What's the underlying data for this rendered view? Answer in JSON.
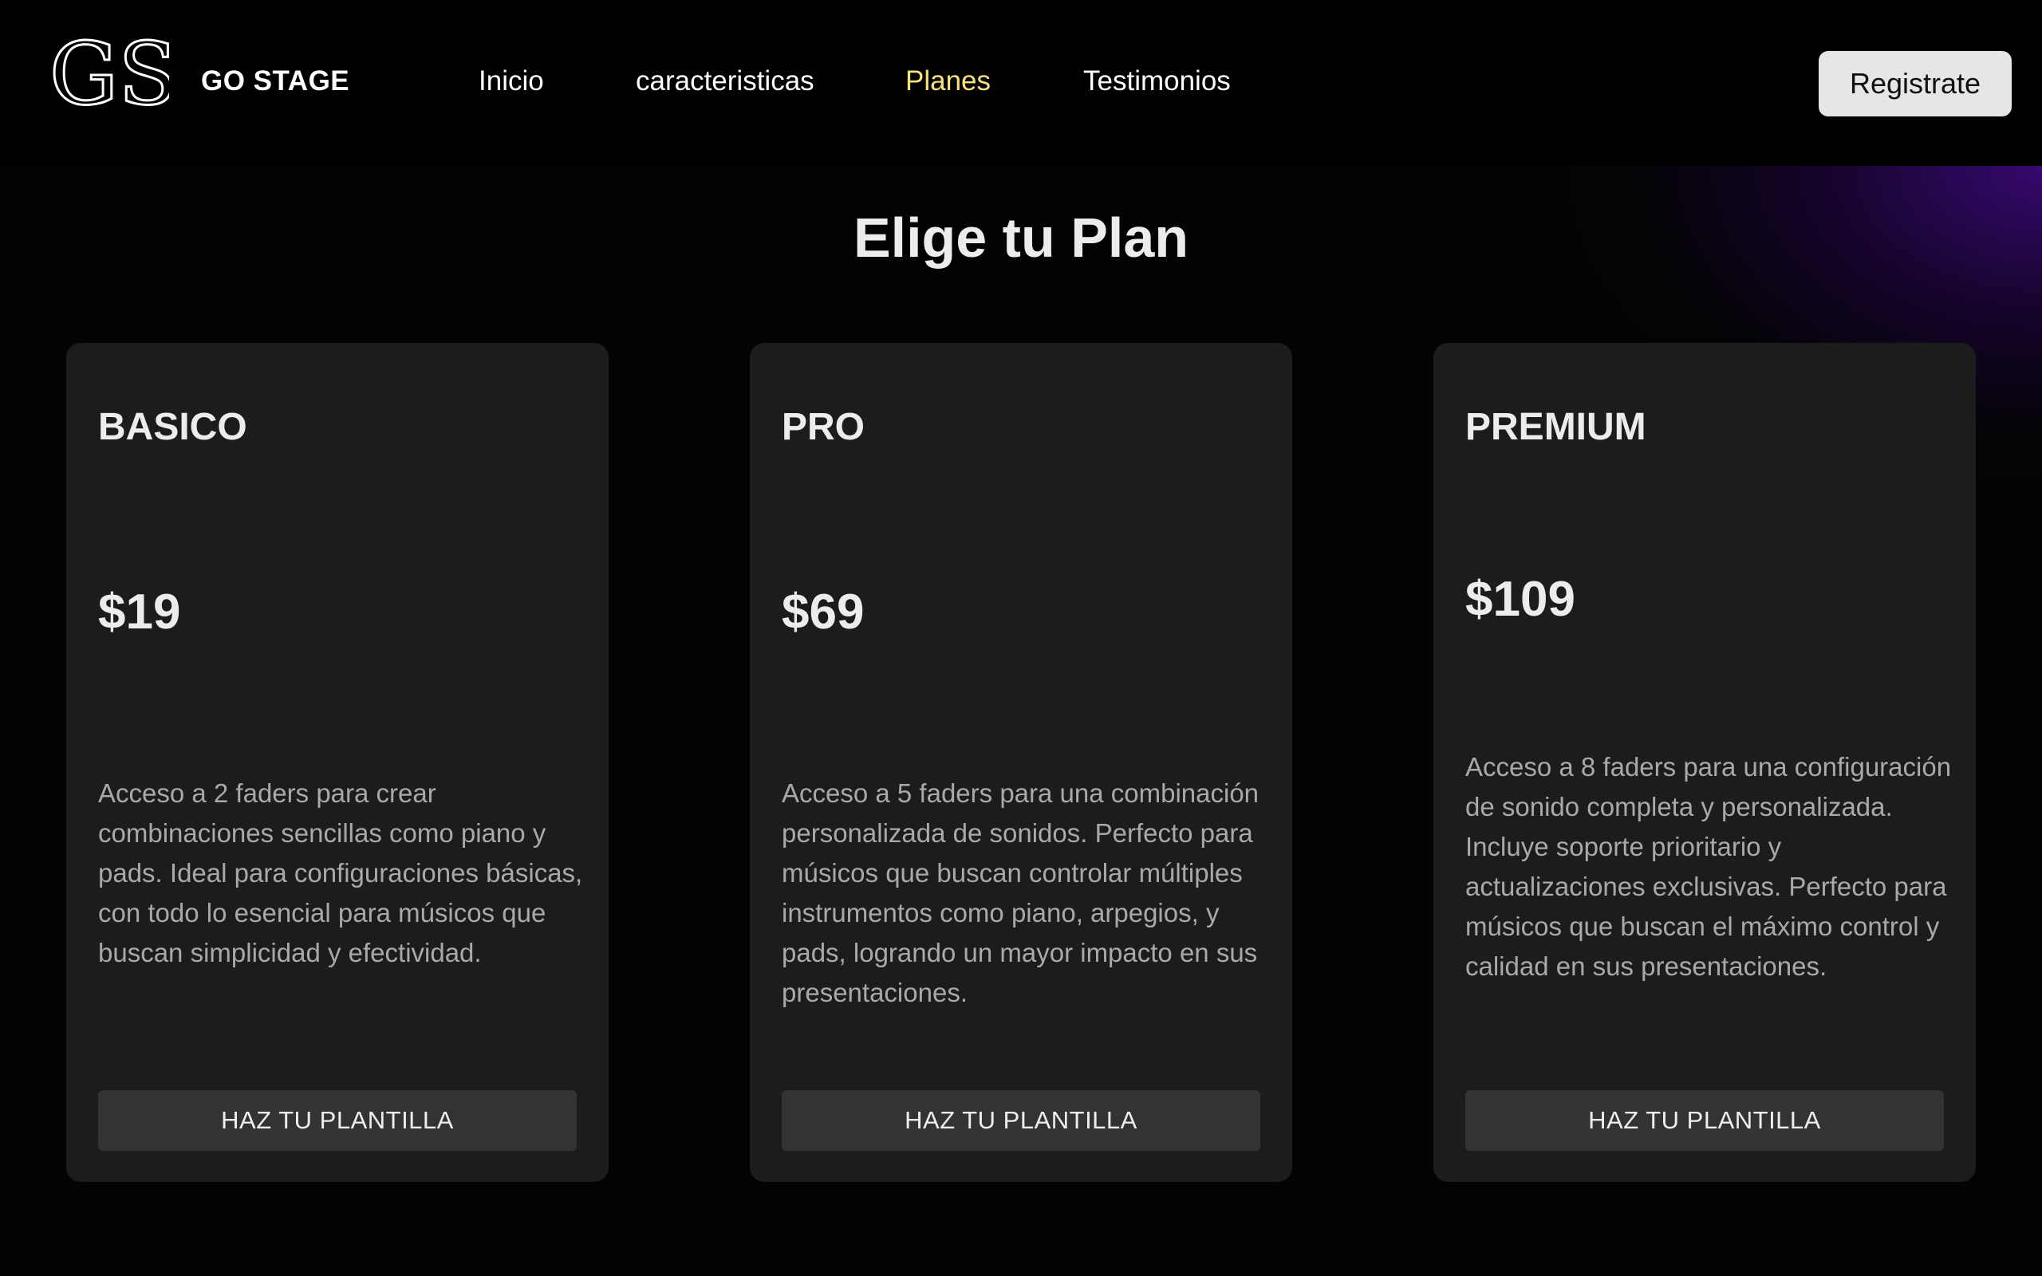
{
  "header": {
    "logo_text": "GS",
    "brand": "GO STAGE",
    "nav": [
      {
        "label": "Inicio",
        "active": false
      },
      {
        "label": "caracteristicas",
        "active": false
      },
      {
        "label": "Planes",
        "active": true
      },
      {
        "label": "Testimonios",
        "active": false
      }
    ],
    "register_label": "Registrate"
  },
  "main": {
    "title": "Elige tu Plan",
    "plans": [
      {
        "name": "BASICO",
        "price": "$19",
        "description": "Acceso a 2 faders para crear combinaciones sencillas como piano y pads. Ideal para configuraciones básicas, con todo lo esencial para músicos que buscan simplicidad y efectividad.",
        "cta": "HAZ TU PLANTILLA"
      },
      {
        "name": "PRO",
        "price": "$69",
        "description": "Acceso a 5 faders para una combinación personalizada de sonidos. Perfecto para músicos que buscan controlar múltiples instrumentos como piano, arpegios, y pads, logrando un mayor impacto en sus presentaciones.",
        "cta": "HAZ TU PLANTILLA"
      },
      {
        "name": "PREMIUM",
        "price": "$109",
        "description": "Acceso a 8 faders para una configuración de sonido completa y personalizada. Incluye soporte prioritario y actualizaciones exclusivas. Perfecto para músicos que buscan el máximo control y calidad en sus presentaciones.",
        "cta": "HAZ TU PLANTILLA"
      }
    ]
  },
  "colors": {
    "background": "#030303",
    "card": "#1c1c1c",
    "active_nav": "#f6e37a",
    "button": "#333333",
    "register_bg": "#e6e6e6",
    "glow": "#400a82"
  }
}
